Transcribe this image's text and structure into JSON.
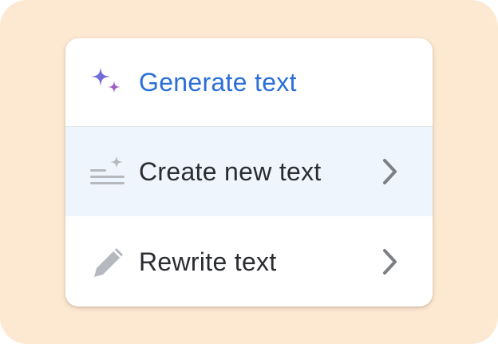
{
  "menu": {
    "header": {
      "label": "Generate text",
      "icon": "sparkle-icon",
      "accent_color": "#2b6fd6"
    },
    "items": [
      {
        "label": "Create new text",
        "icon": "text-lines-sparkle-icon",
        "has_submenu": true,
        "highlighted": true
      },
      {
        "label": "Rewrite text",
        "icon": "pencil-icon",
        "has_submenu": true,
        "highlighted": false
      }
    ]
  },
  "colors": {
    "background": "#fde8d2",
    "highlight": "#eef5fd",
    "sparkle_large": "#6a6fe0",
    "sparkle_small": "#9b5fc0"
  }
}
